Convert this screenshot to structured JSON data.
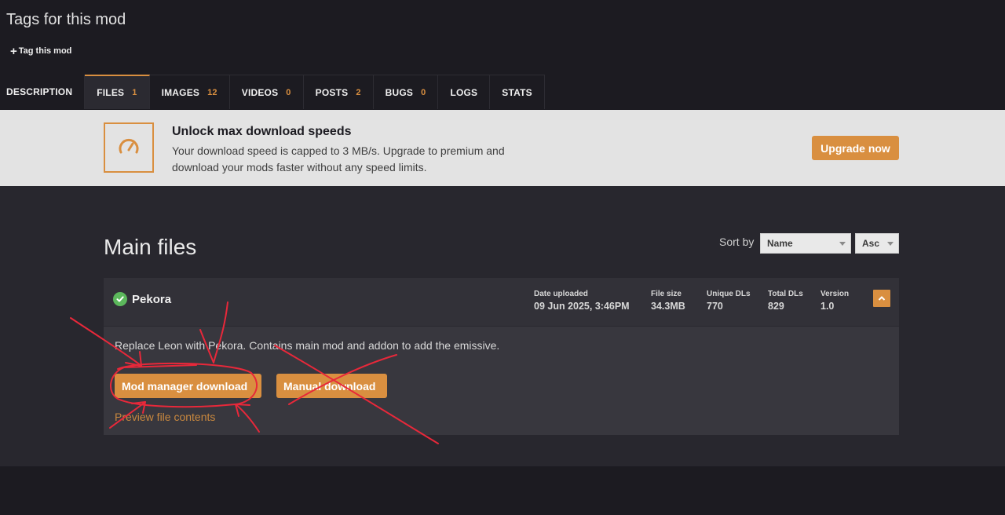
{
  "header": {
    "title": "Tags for this mod",
    "tag_link": "Tag this mod"
  },
  "tabs": [
    {
      "label": "DESCRIPTION",
      "count": ""
    },
    {
      "label": "FILES",
      "count": "1"
    },
    {
      "label": "IMAGES",
      "count": "12"
    },
    {
      "label": "VIDEOS",
      "count": "0"
    },
    {
      "label": "POSTS",
      "count": "2"
    },
    {
      "label": "BUGS",
      "count": "0"
    },
    {
      "label": "LOGS",
      "count": ""
    },
    {
      "label": "STATS",
      "count": ""
    }
  ],
  "active_tab": "FILES",
  "promo": {
    "icon": "speedometer-icon",
    "title": "Unlock max download speeds",
    "text": "Your download speed is capped to 3 MB/s. Upgrade to premium and download your mods faster without any speed limits.",
    "button": "Upgrade now"
  },
  "main": {
    "title": "Main files",
    "sort_label": "Sort by",
    "sort_field": "Name",
    "sort_order": "Asc"
  },
  "file": {
    "name": "Pekora",
    "status_icon": "check-circle-icon",
    "meta": [
      {
        "key": "Date uploaded",
        "value": "09 Jun 2025, 3:46PM"
      },
      {
        "key": "File size",
        "value": "34.3MB"
      },
      {
        "key": "Unique DLs",
        "value": "770"
      },
      {
        "key": "Total DLs",
        "value": "829"
      },
      {
        "key": "Version",
        "value": "1.0"
      }
    ],
    "description": "Replace Leon with Pekora. Contains main mod and addon to add the emissive.",
    "mod_manager_button": "Mod manager download",
    "manual_button": "Manual download",
    "preview_link": "Preview file contents"
  },
  "colors": {
    "accent": "#d98f40",
    "success": "#5cb85c",
    "annotation": "#e8283a"
  }
}
